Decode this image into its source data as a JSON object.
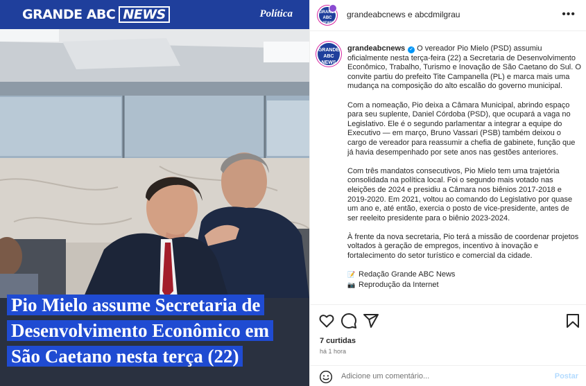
{
  "media": {
    "brand_main": "GRANDE ABC",
    "brand_news": "NEWS",
    "section": "Política",
    "headline": "Pio Mielo assume Secretaria de Desenvolvimento Econômico em São Caetano nesta terça (22)"
  },
  "header": {
    "avatar_text": "GRANDE ABC NEWS",
    "title": "grandeabcnews e abcdmilgrau",
    "more_icon": "more-horizontal-icon"
  },
  "caption": {
    "username": "grandeabcnews",
    "verified_icon": "verified-badge-icon",
    "paragraphs": [
      "O vereador Pio Mielo (PSD) assumiu oficialmente nesta terça-feira (22) a Secretaria de Desenvolvimento Econômico, Trabalho, Turismo e Inovação de São Caetano do Sul. O convite partiu do prefeito Tite Campanella (PL) e marca mais uma mudança na composição do alto escalão do governo municipal.",
      "Com a nomeação, Pio deixa a Câmara Municipal, abrindo espaço para seu suplente, Daniel Córdoba (PSD), que ocupará a vaga no Legislativo. Ele é o segundo parlamentar a integrar a equipe do Executivo — em março, Bruno Vassari (PSB) também deixou o cargo de vereador para reassumir a chefia de gabinete, função que já havia desempenhado por sete anos nas gestões anteriores.",
      "Com três mandatos consecutivos, Pio Mielo tem uma trajetória consolidada na política local. Foi o segundo mais votado nas eleições de 2024 e presidiu a Câmara nos biênios 2017-2018 e 2019-2020. Em 2021, voltou ao comando do Legislativo por quase um ano e, até então, exercia o posto de vice-presidente, antes de ser reeleito presidente para o biênio 2023-2024.",
      "À frente da nova secretaria, Pio terá a missão de coordenar projetos voltados à geração de empregos, incentivo à inovação e fortalecimento do setor turístico e comercial da cidade."
    ],
    "credits": [
      {
        "icon": "memo-icon",
        "glyph": "📝",
        "text": "Redação Grande ABC News"
      },
      {
        "icon": "camera-icon",
        "glyph": "📷",
        "text": "Reprodução da Internet"
      }
    ]
  },
  "actions": {
    "like_icon": "heart-icon",
    "comment_icon": "comment-icon",
    "share_icon": "share-icon",
    "save_icon": "bookmark-icon"
  },
  "likes": "7 curtidas",
  "time": "há 1 hora",
  "comment": {
    "placeholder": "Adicione um comentário...",
    "post_label": "Postar",
    "emoji_icon": "emoji-icon"
  },
  "colors": {
    "brand_blue": "#1f3f9c",
    "headline_blue": "#1f4bd2",
    "link_blue": "#0095f6",
    "post_disabled": "#b3dbff"
  }
}
